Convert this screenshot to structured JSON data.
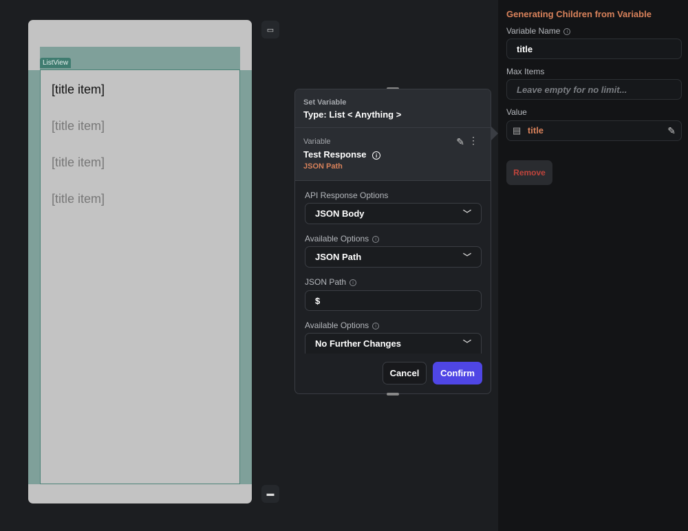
{
  "canvas": {
    "listview_tag": "ListView",
    "items": [
      "[title item]",
      "[title item]",
      "[title item]",
      "[title item]"
    ]
  },
  "popup": {
    "header_label": "Set Variable",
    "type": "Type: List < Anything >",
    "variable_label": "Variable",
    "variable_name": "Test Response",
    "variable_source": "JSON Path",
    "api_label": "API Response Options",
    "api_value": "JSON Body",
    "avail1_label": "Available Options",
    "avail1_value": "JSON Path",
    "jsonpath_label": "JSON Path",
    "jsonpath_value": "$",
    "avail2_label": "Available Options",
    "avail2_value": "No Further Changes",
    "cancel": "Cancel",
    "confirm": "Confirm"
  },
  "panel": {
    "title": "Generating Children from Variable",
    "var_name_label": "Variable Name",
    "var_name_value": "title",
    "max_items_label": "Max Items",
    "max_items_placeholder": "Leave empty for no limit...",
    "value_label": "Value",
    "value": "title",
    "remove": "Remove"
  },
  "colors": {
    "accent": "#4f46e5",
    "orange": "#d9825b",
    "remove": "#c0443c"
  }
}
